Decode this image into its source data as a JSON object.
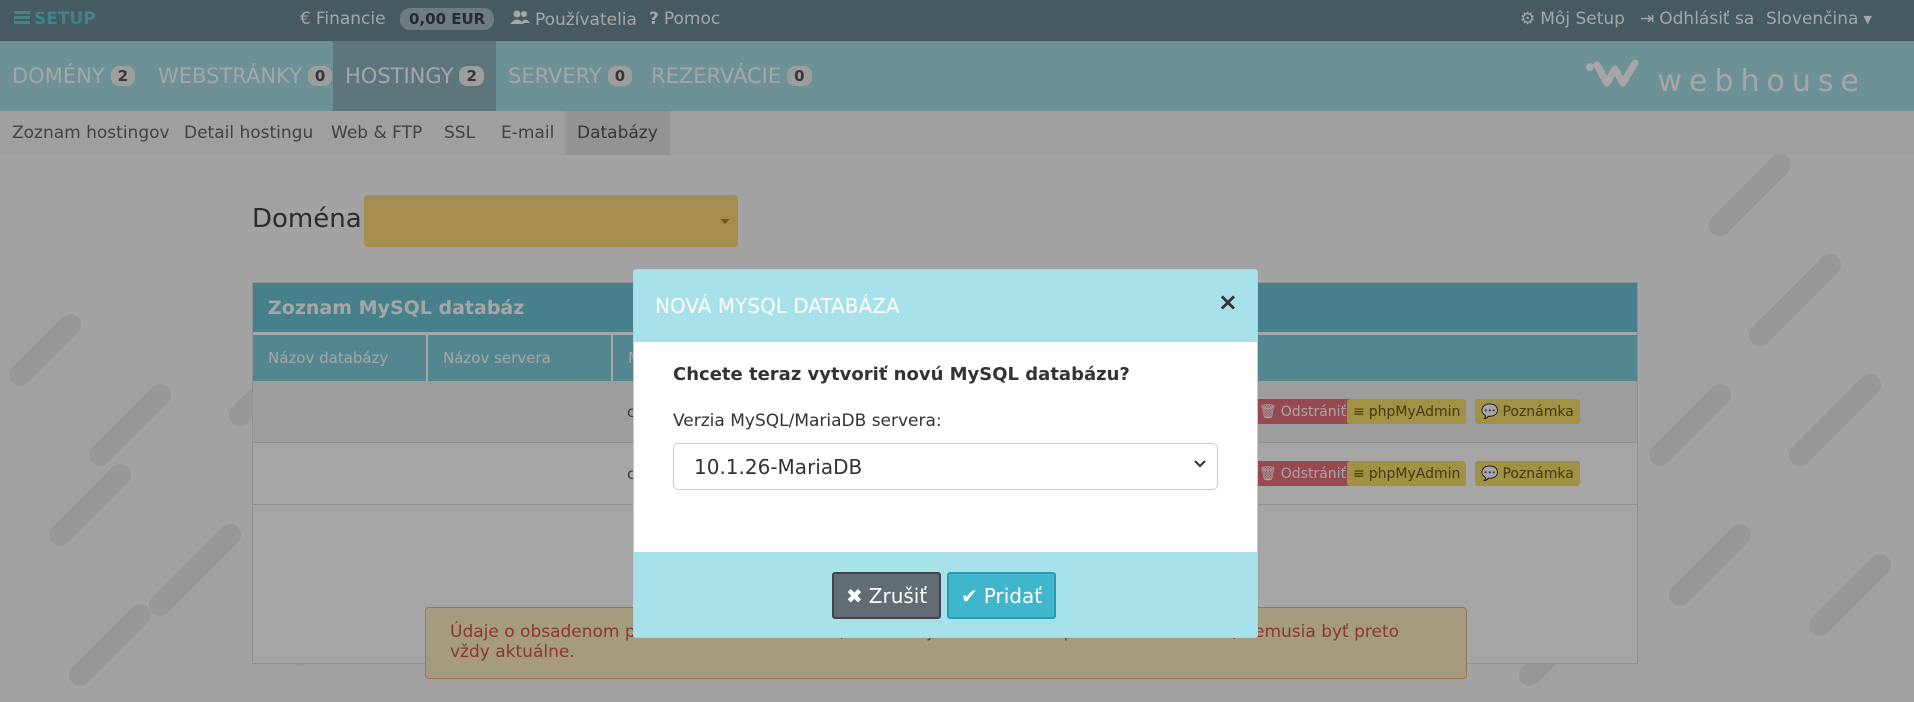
{
  "topbar": {
    "brand": "SETUP",
    "financie": "Financie",
    "balance": "0,00 EUR",
    "pouzivatelia": "Používatelia",
    "pomoc": "Pomoc",
    "moj_setup": "Môj Setup",
    "odhlasit": "Odhlásiť sa",
    "language": "Slovenčina"
  },
  "mainnav": {
    "tabs": [
      {
        "label": "DOMÉNY",
        "count": "2"
      },
      {
        "label": "WEBSTRÁNKY",
        "count": "0"
      },
      {
        "label": "HOSTINGY",
        "count": "2"
      },
      {
        "label": "SERVERY",
        "count": "0"
      },
      {
        "label": "REZERVÁCIE",
        "count": "0"
      }
    ],
    "logo": "webhouse"
  },
  "subnav": {
    "items": [
      "Zoznam hostingov",
      "Detail hostingu",
      "Web & FTP",
      "SSL",
      "E-mail",
      "Databázy"
    ]
  },
  "page": {
    "domena_label": "Doména",
    "panel_title": "Zoznam MySQL databáz",
    "columns": [
      "Názov databázy",
      "Názov servera",
      "M"
    ],
    "row_actions": {
      "delete": "Odstrániť",
      "phpmyadmin": "phpMyAdmin",
      "note": "Poznámka"
    },
    "row_cell_text": "c",
    "info_text": "Údaje o obsadenom priestore sú informatívne, aktualizujú sa raz denne pri zaťažení servera, nemusia byť preto vždy aktuálne."
  },
  "modal": {
    "title": "NOVÁ MYSQL DATABÁZA",
    "close": "×",
    "question": "Chcete teraz vytvoriť novú MySQL databázu?",
    "version_label": "Verzia MySQL/MariaDB servera:",
    "version_value": "10.1.26-MariaDB",
    "cancel_label": "Zrušiť",
    "add_label": "Pridať"
  },
  "colors": {
    "topbar": "#6b8a96",
    "nav": "#a6e0ea",
    "modal_header": "#a7e1ea",
    "add_button": "#3fb6cc",
    "cancel_button": "#616c73"
  }
}
